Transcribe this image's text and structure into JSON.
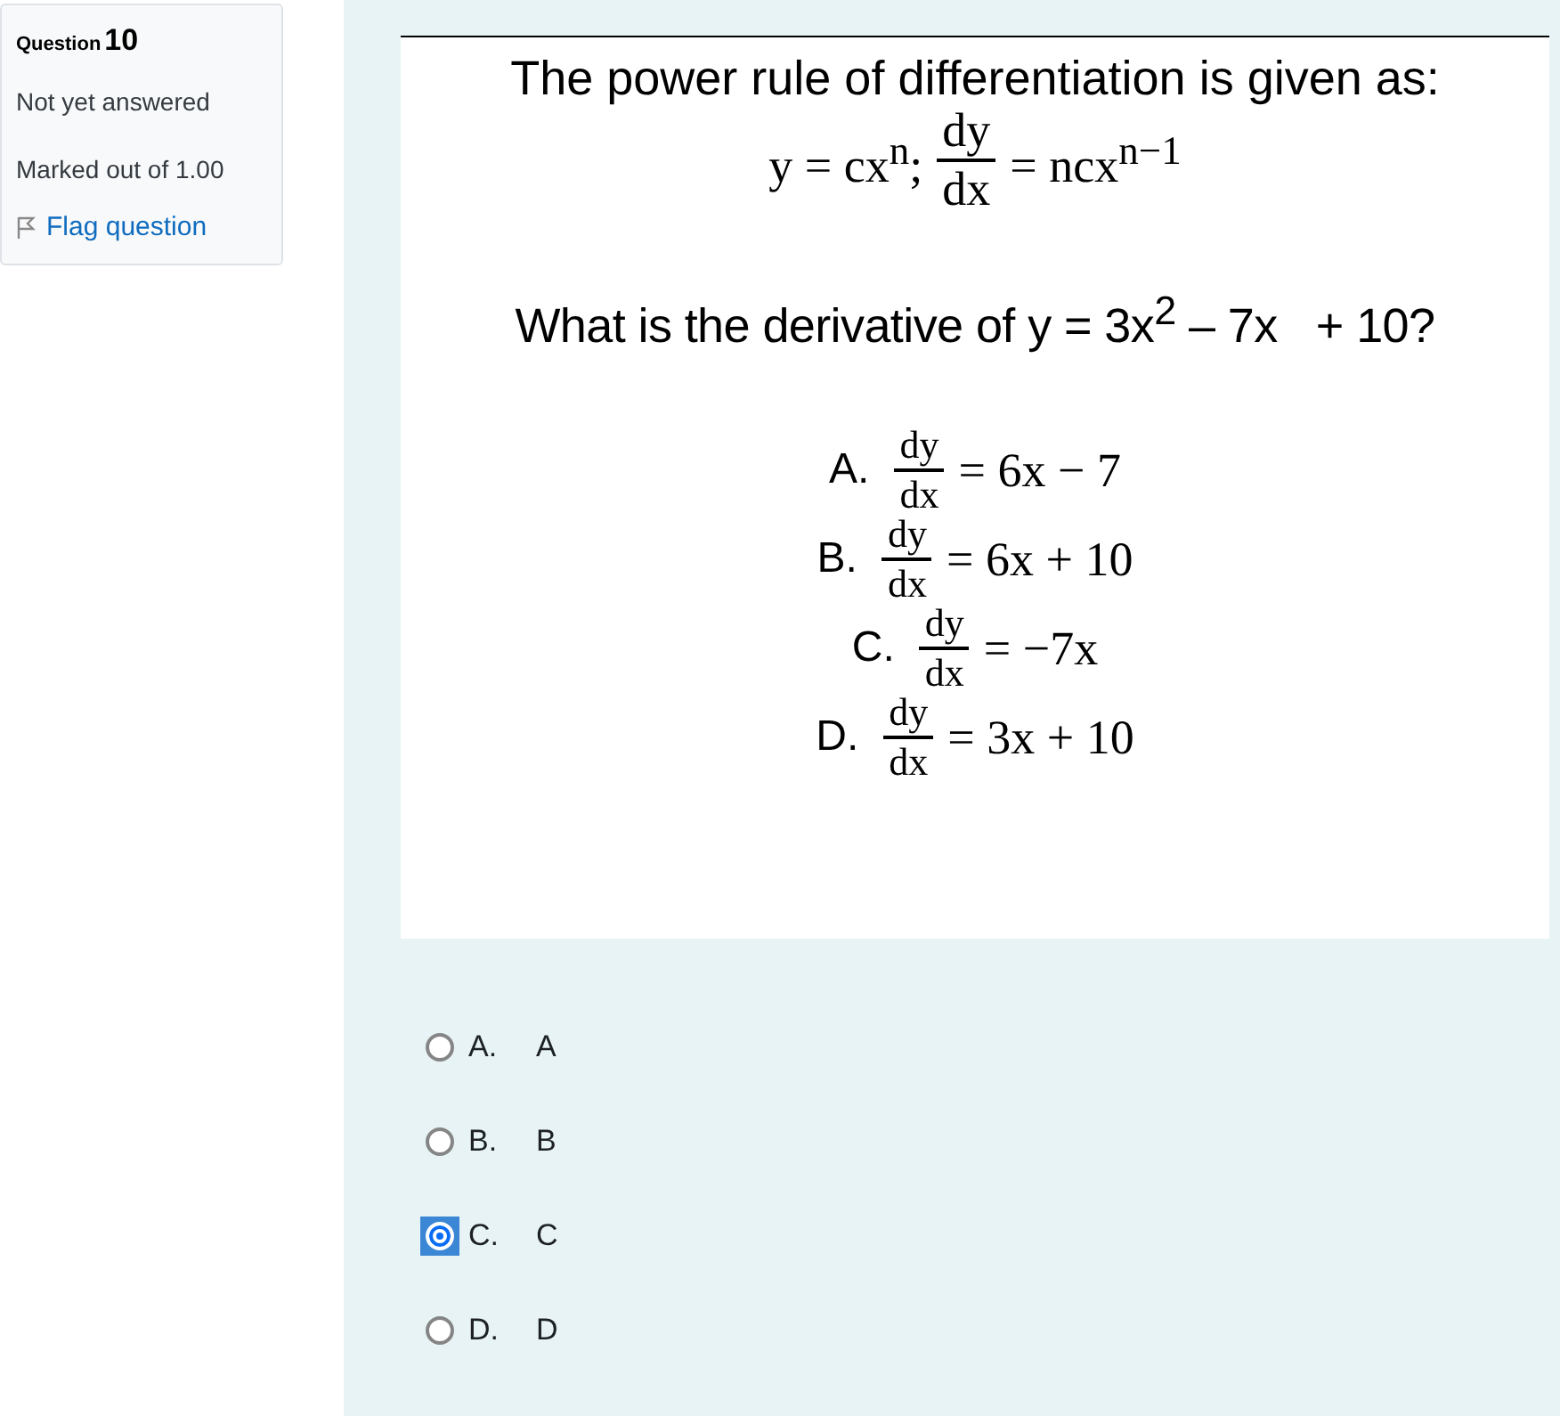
{
  "info": {
    "question_label": "Question",
    "question_number": "10",
    "status": "Not yet answered",
    "marks": "Marked out of 1.00",
    "flag": "Flag question"
  },
  "question": {
    "heading": "The power rule of differentiation is given as:",
    "rule": {
      "lhs": "y = cx$^{n}$;",
      "numerator": "dy",
      "denominator": "dx",
      "rhs": "= ncx$^{n−1}$"
    },
    "prompt": "What is the derivative of y = 3x$^{2}$ – 7x   + 10?",
    "choices": [
      {
        "label": "A.",
        "numerator": "dy",
        "denominator": "dx",
        "rhs": "= 6x − 7"
      },
      {
        "label": "B.",
        "numerator": "dy",
        "denominator": "dx",
        "rhs": "= 6x + 10"
      },
      {
        "label": "C.",
        "numerator": "dy",
        "denominator": "dx",
        "rhs": "= −7x"
      },
      {
        "label": "D.",
        "numerator": "dy",
        "denominator": "dx",
        "rhs": "= 3x + 10"
      }
    ]
  },
  "answers": [
    {
      "letter": "A.",
      "text": "A",
      "selected": false
    },
    {
      "letter": "B.",
      "text": "B",
      "selected": false
    },
    {
      "letter": "C.",
      "text": "C",
      "selected": true
    },
    {
      "letter": "D.",
      "text": "D",
      "selected": false
    }
  ]
}
